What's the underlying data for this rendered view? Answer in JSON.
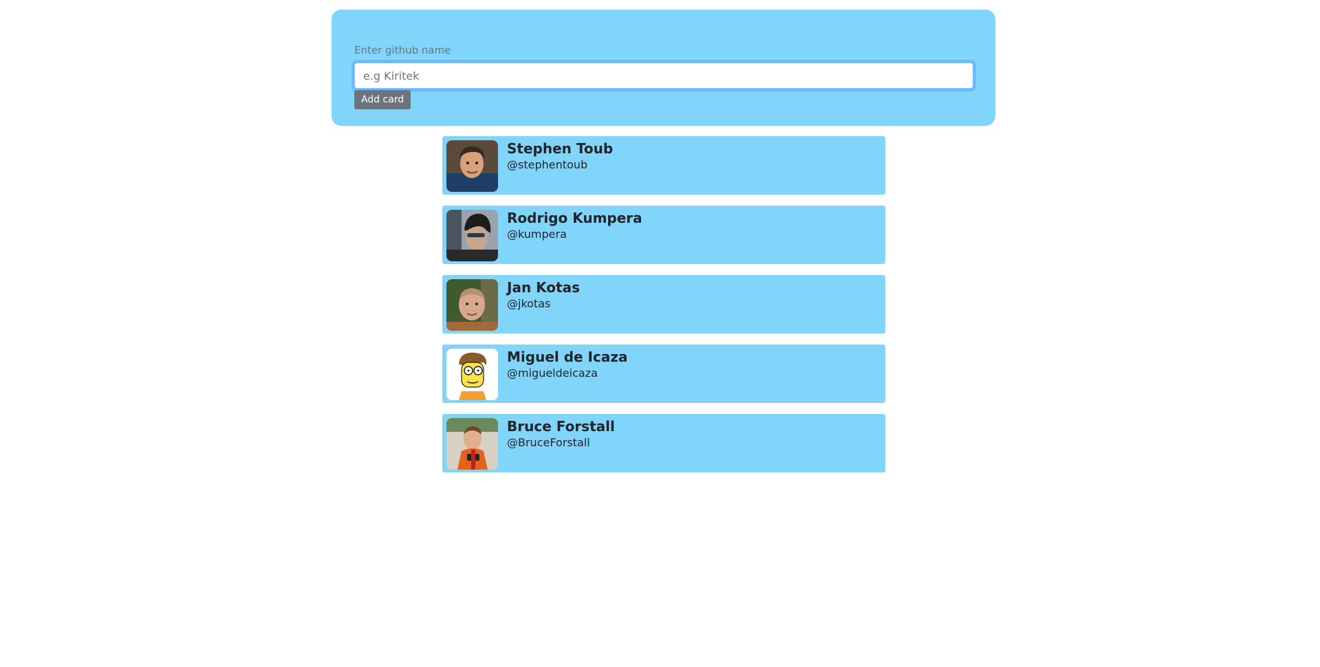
{
  "form": {
    "label": "Enter github name",
    "input_value": "",
    "input_placeholder": "e.g Kiritek",
    "add_button_label": "Add card"
  },
  "cards": [
    {
      "name": "Stephen Toub",
      "login": "@stephentoub"
    },
    {
      "name": "Rodrigo Kumpera",
      "login": "@kumpera"
    },
    {
      "name": "Jan Kotas",
      "login": "@jkotas"
    },
    {
      "name": "Miguel de Icaza",
      "login": "@migueldeicaza"
    },
    {
      "name": "Bruce Forstall",
      "login": "@BruceForstall"
    }
  ],
  "colors": {
    "panel_background": "#81d4fa",
    "card_background": "#81d4fa",
    "button_background": "#6c757d",
    "focus_ring": "#80bdff"
  }
}
